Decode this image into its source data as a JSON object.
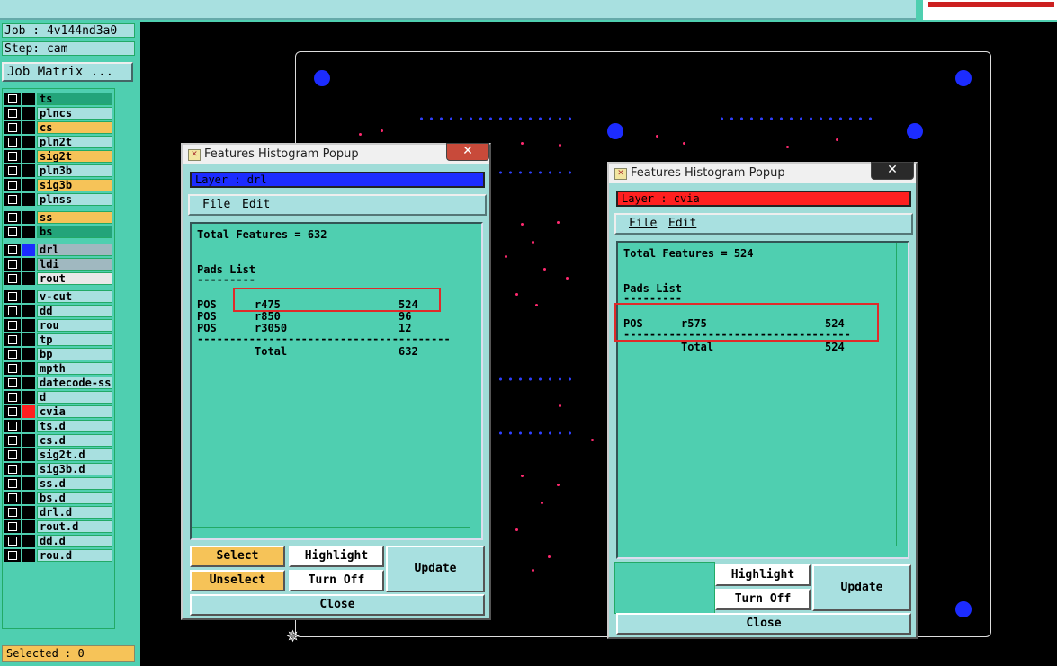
{
  "header": {
    "job": "Job : 4v144nd3a0",
    "step": "Step: cam",
    "job_matrix": "Job Matrix ..."
  },
  "layers": [
    {
      "name": "ts",
      "color": "#23a47a",
      "swatch": "#000"
    },
    {
      "name": "plncs",
      "color": "#a8e0e0",
      "swatch": "#000"
    },
    {
      "name": "cs",
      "color": "#f6c358",
      "swatch": "#000"
    },
    {
      "name": "pln2t",
      "color": "#a8e0e0",
      "swatch": "#000"
    },
    {
      "name": "sig2t",
      "color": "#f6c358",
      "swatch": "#000"
    },
    {
      "name": "pln3b",
      "color": "#a8e0e0",
      "swatch": "#000"
    },
    {
      "name": "sig3b",
      "color": "#f6c358",
      "swatch": "#000"
    },
    {
      "name": "plnss",
      "color": "#a8e0e0",
      "swatch": "#000"
    },
    {
      "name": "ss",
      "color": "#f6c358",
      "swatch": "#000"
    },
    {
      "name": "bs",
      "color": "#23a47a",
      "swatch": "#000"
    },
    {
      "name": "drl",
      "color": "#a0b8c0",
      "swatch": "#1c2cff"
    },
    {
      "name": "ldi",
      "color": "#a0b8c0",
      "swatch": "#000"
    },
    {
      "name": "rout",
      "color": "#e8e8e8",
      "swatch": "#000"
    },
    {
      "name": "v-cut",
      "color": "#a8e0e0",
      "swatch": "#000"
    },
    {
      "name": "dd",
      "color": "#a8e0e0",
      "swatch": "#000"
    },
    {
      "name": "rou",
      "color": "#a8e0e0",
      "swatch": "#000"
    },
    {
      "name": "tp",
      "color": "#a8e0e0",
      "swatch": "#000"
    },
    {
      "name": "bp",
      "color": "#a8e0e0",
      "swatch": "#000"
    },
    {
      "name": "mpth",
      "color": "#a8e0e0",
      "swatch": "#000"
    },
    {
      "name": "datecode-ss",
      "color": "#a8e0e0",
      "swatch": "#000"
    },
    {
      "name": "d",
      "color": "#a8e0e0",
      "swatch": "#000"
    },
    {
      "name": "cvia",
      "color": "#a8e0e0",
      "swatch": "#ff2020"
    },
    {
      "name": "ts.d",
      "color": "#a8e0e0",
      "swatch": "#000"
    },
    {
      "name": "cs.d",
      "color": "#a8e0e0",
      "swatch": "#000"
    },
    {
      "name": "sig2t.d",
      "color": "#a8e0e0",
      "swatch": "#000"
    },
    {
      "name": "sig3b.d",
      "color": "#a8e0e0",
      "swatch": "#000"
    },
    {
      "name": "ss.d",
      "color": "#a8e0e0",
      "swatch": "#000"
    },
    {
      "name": "bs.d",
      "color": "#a8e0e0",
      "swatch": "#000"
    },
    {
      "name": "drl.d",
      "color": "#a8e0e0",
      "swatch": "#000"
    },
    {
      "name": "rout.d",
      "color": "#a8e0e0",
      "swatch": "#000"
    },
    {
      "name": "dd.d",
      "color": "#a8e0e0",
      "swatch": "#000"
    },
    {
      "name": "rou.d",
      "color": "#a8e0e0",
      "swatch": "#000"
    }
  ],
  "selected": "Selected : 0",
  "popup1": {
    "title": "Features Histogram Popup",
    "close_glyph": "✕",
    "layer": "Layer :  drl",
    "layer_color": "#1c2cff",
    "menu_file": "File",
    "menu_edit": "Edit",
    "total_line": "Total Features = 632",
    "pads_title": "Pads List",
    "pads_underline": "---------",
    "rows": [
      {
        "type": "POS",
        "sym": "r475",
        "count": "524"
      },
      {
        "type": "POS",
        "sym": "r850",
        "count": "96"
      },
      {
        "type": "POS",
        "sym": "r3050",
        "count": "12"
      }
    ],
    "separator": "---------------------------------------",
    "total_label": "Total",
    "total_value": "632",
    "btn_select": "Select",
    "btn_highlight": "Highlight",
    "btn_update": "Update",
    "btn_unselect": "Unselect",
    "btn_turnoff": "Turn Off",
    "btn_close": "Close"
  },
  "popup2": {
    "title": "Features Histogram Popup",
    "close_glyph": "✕",
    "layer": "Layer :  cvia",
    "layer_color": "#ff2020",
    "menu_file": "File",
    "menu_edit": "Edit",
    "total_line": "Total Features = 524",
    "pads_title": "Pads List",
    "pads_underline": "---------",
    "rows": [
      {
        "type": "POS",
        "sym": "r575",
        "count": "524"
      }
    ],
    "separator": "-----------------------------------",
    "total_label": "Total",
    "total_value": "524",
    "btn_highlight": "Highlight",
    "btn_update": "Update",
    "btn_turnoff": "Turn Off",
    "btn_close": "Close"
  }
}
